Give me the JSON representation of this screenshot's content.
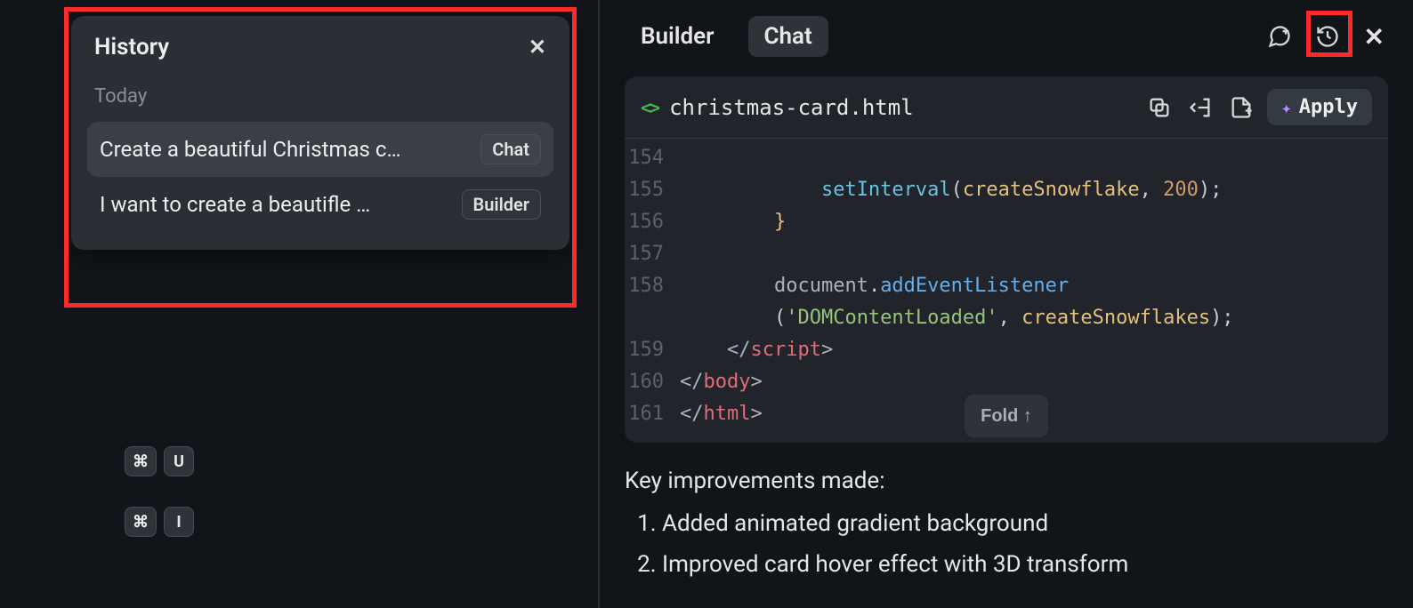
{
  "history": {
    "title": "History",
    "section": "Today",
    "items": [
      {
        "title": "Create a beautiful Christmas c…",
        "badge": "Chat",
        "selected": true
      },
      {
        "title": "I want to create a beautifle …",
        "badge": "Builder",
        "selected": false
      }
    ]
  },
  "shortcuts": {
    "row1": [
      "⌘",
      "U"
    ],
    "row2": [
      "⌘",
      "I"
    ]
  },
  "tabs": {
    "builder": "Builder",
    "chat": "Chat"
  },
  "code": {
    "filename": "christmas-card.html",
    "apply_label": "Apply",
    "fold_label": "Fold  ↑",
    "lines": [
      {
        "n": "154",
        "html": ""
      },
      {
        "n": "155",
        "html": "            <span class='tok-fn'>setInterval</span><span class='tok-punc'>(</span><span class='tok-call'>createSnowflake</span><span class='tok-punc'>, </span><span class='tok-num'>200</span><span class='tok-punc'>);</span>"
      },
      {
        "n": "156",
        "html": "        <span class='tok-brace'>}</span>"
      },
      {
        "n": "157",
        "html": ""
      },
      {
        "n": "158",
        "html": "        <span class='tok-ident'>document</span><span class='tok-punc'>.</span><span class='tok-prop'>addEventListener</span><br>        <span class='tok-punc'>(</span><span class='tok-str'>'DOMContentLoaded'</span><span class='tok-punc'>, </span><span class='tok-call'>createSnowflakes</span><span class='tok-punc'>);</span>"
      },
      {
        "n": "159",
        "html": "    <span class='tok-tag-angle'>&lt;/</span><span class='tok-tag'>script</span><span class='tok-tag-angle'>&gt;</span>"
      },
      {
        "n": "160",
        "html": "<span class='tok-tag-angle'>&lt;/</span><span class='tok-tag'>body</span><span class='tok-tag-angle'>&gt;</span>"
      },
      {
        "n": "161",
        "html": "<span class='tok-tag-angle'>&lt;/</span><span class='tok-tag'>html</span><span class='tok-tag-angle'>&gt;</span>"
      }
    ]
  },
  "prose": {
    "heading": "Key improvements made:",
    "items": [
      "Added animated gradient background",
      "Improved card hover effect with 3D transform"
    ]
  }
}
